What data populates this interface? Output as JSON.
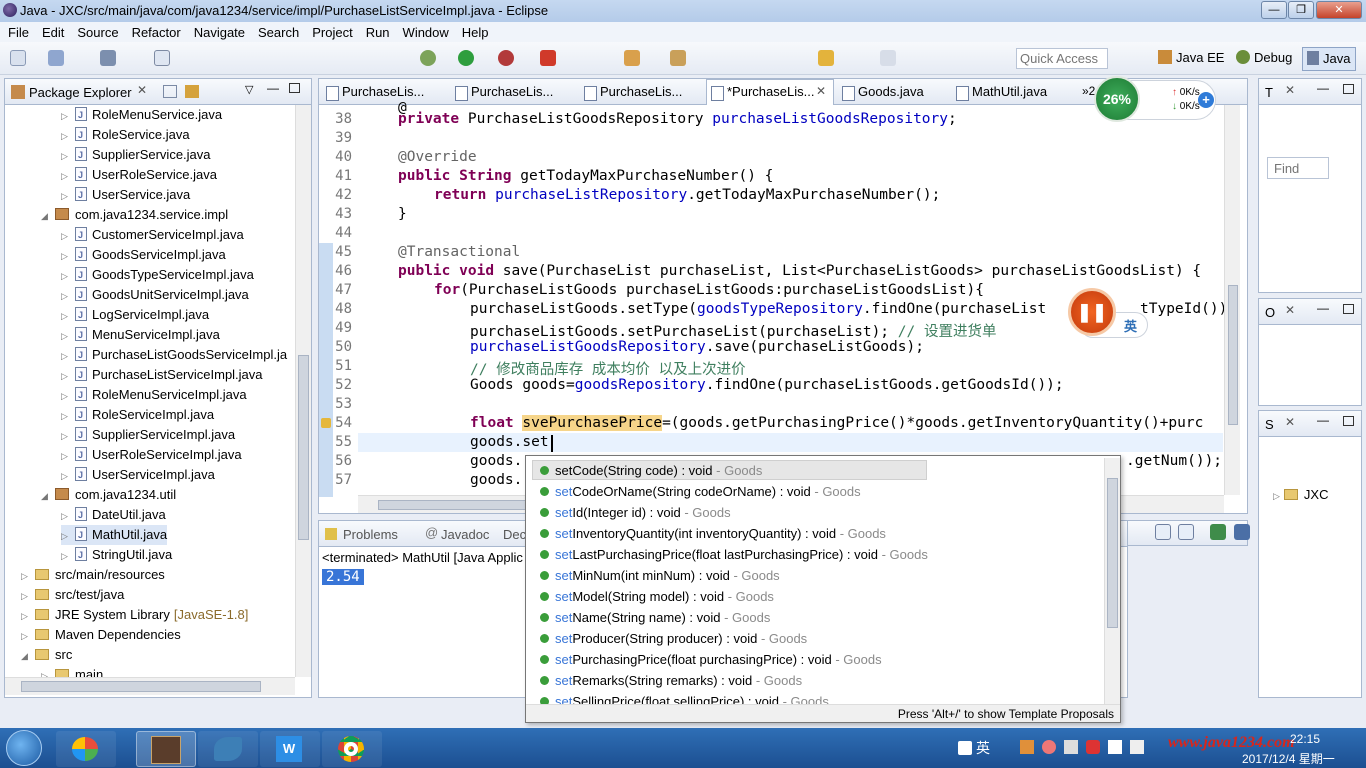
{
  "window": {
    "title": "Java - JXC/src/main/java/com/java1234/service/impl/PurchaseListServiceImpl.java - Eclipse",
    "min": "—",
    "max": "❐",
    "close": "✕"
  },
  "menu": [
    "File",
    "Edit",
    "Source",
    "Refactor",
    "Navigate",
    "Search",
    "Project",
    "Run",
    "Window",
    "Help"
  ],
  "toolbar": {
    "quick_access_placeholder": "Quick Access",
    "perspectives": [
      "Java EE",
      "Debug",
      "Java"
    ]
  },
  "package_explorer": {
    "title": "Package Explorer",
    "items": [
      {
        "label": "RoleMenuService.java",
        "type": "file",
        "indent": 3
      },
      {
        "label": "RoleService.java",
        "type": "file",
        "indent": 3
      },
      {
        "label": "SupplierService.java",
        "type": "file",
        "indent": 3
      },
      {
        "label": "UserRoleService.java",
        "type": "file",
        "indent": 3
      },
      {
        "label": "UserService.java",
        "type": "file",
        "indent": 3
      },
      {
        "label": "com.java1234.service.impl",
        "type": "pkg",
        "indent": 2
      },
      {
        "label": "CustomerServiceImpl.java",
        "type": "file",
        "indent": 3
      },
      {
        "label": "GoodsServiceImpl.java",
        "type": "file",
        "indent": 3
      },
      {
        "label": "GoodsTypeServiceImpl.java",
        "type": "file",
        "indent": 3
      },
      {
        "label": "GoodsUnitServiceImpl.java",
        "type": "file",
        "indent": 3
      },
      {
        "label": "LogServiceImpl.java",
        "type": "file",
        "indent": 3
      },
      {
        "label": "MenuServiceImpl.java",
        "type": "file",
        "indent": 3
      },
      {
        "label": "PurchaseListGoodsServiceImpl.ja",
        "type": "file",
        "indent": 3
      },
      {
        "label": "PurchaseListServiceImpl.java",
        "type": "file",
        "indent": 3
      },
      {
        "label": "RoleMenuServiceImpl.java",
        "type": "file",
        "indent": 3
      },
      {
        "label": "RoleServiceImpl.java",
        "type": "file",
        "indent": 3
      },
      {
        "label": "SupplierServiceImpl.java",
        "type": "file",
        "indent": 3
      },
      {
        "label": "UserRoleServiceImpl.java",
        "type": "file",
        "indent": 3
      },
      {
        "label": "UserServiceImpl.java",
        "type": "file",
        "indent": 3
      },
      {
        "label": "com.java1234.util",
        "type": "pkg",
        "indent": 2
      },
      {
        "label": "DateUtil.java",
        "type": "file",
        "indent": 3
      },
      {
        "label": "MathUtil.java",
        "type": "file",
        "indent": 3
      },
      {
        "label": "StringUtil.java",
        "type": "file",
        "indent": 3
      },
      {
        "label": "src/main/resources",
        "type": "folder",
        "indent": 1
      },
      {
        "label": "src/test/java",
        "type": "folder",
        "indent": 1
      },
      {
        "label": "JRE System Library",
        "suffix": "[JavaSE-1.8]",
        "type": "lib",
        "indent": 1
      },
      {
        "label": "Maven Dependencies",
        "type": "lib",
        "indent": 1
      },
      {
        "label": "src",
        "type": "folder",
        "indent": 1
      },
      {
        "label": "main",
        "type": "folder",
        "indent": 2
      }
    ]
  },
  "editor_tabs": [
    "PurchaseLis...",
    "PurchaseLis...",
    "PurchaseLis...",
    "*PurchaseLis...",
    "Goods.java",
    "MathUtil.java"
  ],
  "tabs_overflow": "»2",
  "line_numbers": [
    "38",
    "39",
    "40",
    "41",
    "42",
    "43",
    "44",
    "45",
    "46",
    "47",
    "48",
    "49",
    "50",
    "51",
    "52",
    "53",
    "54",
    "55",
    "56",
    "57"
  ],
  "code_lines": [
    "@",
    "private PurchaseListGoodsRepository purchaseListGoodsRepository;",
    "",
    "@Override",
    "public String getTodayMaxPurchaseNumber() {",
    "return purchaseListRepository.getTodayMaxPurchaseNumber();",
    "}",
    "",
    "@Transactional",
    "public void save(PurchaseList purchaseList, List<PurchaseListGoods> purchaseListGoodsList) {",
    "for(PurchaseListGoods purchaseListGoods:purchaseListGoodsList){",
    "purchaseListGoods.setType(goodsTypeRepository.findOne(purchaseList",
    "tTypeId());",
    "purchaseListGoods.setPurchaseList(purchaseList); // 设置进货单",
    "purchaseListGoodsRepository.save(purchaseListGoods);",
    "// 修改商品库存 成本均价 以及上次进价",
    "Goods goods=goodsRepository.findOne(purchaseListGoods.getGoodsId());",
    "float svePurchasePrice=(goods.getPurchasingPrice()*goods.getInventoryQuantity()+purc",
    "goods.set",
    "goods.",
    ".getNum());",
    "goods."
  ],
  "bottom_tabs": [
    "Problems",
    "Javadoc",
    "Dec"
  ],
  "console": {
    "status": "<terminated> MathUtil [Java Applic",
    "output": "2.54"
  },
  "content_assist": {
    "items": [
      {
        "prefix": "set",
        "name": "Code(String code) : void",
        "cls": " - Goods"
      },
      {
        "prefix": "set",
        "name": "CodeOrName(String codeOrName) : void",
        "cls": " - Goods"
      },
      {
        "prefix": "set",
        "name": "Id(Integer id) : void",
        "cls": " - Goods"
      },
      {
        "prefix": "set",
        "name": "InventoryQuantity(int inventoryQuantity) : void",
        "cls": " - Goods"
      },
      {
        "prefix": "set",
        "name": "LastPurchasingPrice(float lastPurchasingPrice) : void",
        "cls": " - Goods"
      },
      {
        "prefix": "set",
        "name": "MinNum(int minNum) : void",
        "cls": " - Goods"
      },
      {
        "prefix": "set",
        "name": "Model(String model) : void",
        "cls": " - Goods"
      },
      {
        "prefix": "set",
        "name": "Name(String name) : void",
        "cls": " - Goods"
      },
      {
        "prefix": "set",
        "name": "Producer(String producer) : void",
        "cls": " - Goods"
      },
      {
        "prefix": "set",
        "name": "PurchasingPrice(float purchasingPrice) : void",
        "cls": " - Goods"
      },
      {
        "prefix": "set",
        "name": "Remarks(String remarks) : void",
        "cls": " - Goods"
      },
      {
        "prefix": "set",
        "name": "SellingPrice(float sellingPrice) : void",
        "cls": " - Goods"
      }
    ],
    "footer": "Press 'Alt+/' to show Template Proposals"
  },
  "right_panels": {
    "find_placeholder": "Find",
    "tree_item": "JXC",
    "t_label": "T",
    "o_label": "O",
    "s_label": "S"
  },
  "overlay": {
    "cpu": "26%",
    "net_up": "0K/s",
    "net_down": "0K/s",
    "ime": "英"
  },
  "taskbar": {
    "ime": "英",
    "watermark": "www.java1234.com",
    "time": "22:15",
    "date": "2017/12/4 星期一"
  },
  "colors": {
    "accent": "#3875d7",
    "keyword": "#7f0055",
    "field": "#0000c0",
    "comment": "#3f7f5f"
  }
}
